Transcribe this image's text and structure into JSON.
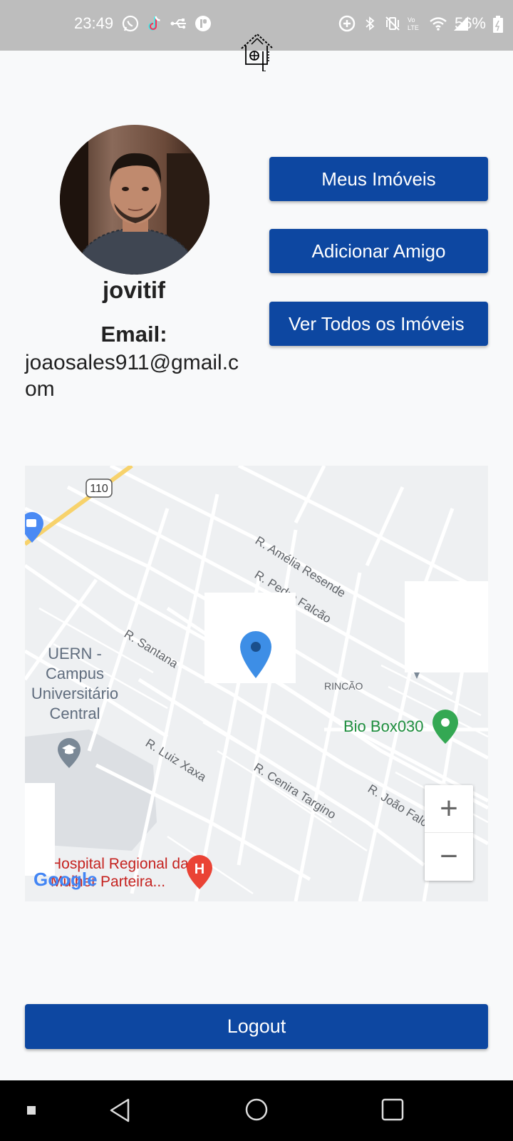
{
  "status_bar": {
    "time": "23:49",
    "battery": "56%",
    "left_icons": [
      "whatsapp-icon",
      "tiktok-icon",
      "usb-icon",
      "app-icon"
    ],
    "right_icons": [
      "data-saver-icon",
      "bluetooth-icon",
      "vibrate-icon",
      "volte-icon",
      "wifi-icon",
      "signal-icon"
    ]
  },
  "app": {
    "logo_icon": "house-location-icon"
  },
  "profile": {
    "username": "jovitif",
    "email_label": "Email:",
    "email": "joaosales911@gmail.com"
  },
  "actions": {
    "my_properties": "Meus Imóveis",
    "add_friend": "Adicionar Amigo",
    "view_all_properties": "Ver Todos os Imóveis"
  },
  "map": {
    "highway_number": "110",
    "streets": [
      "R. Amélia Resende",
      "R. Pedro Falcão",
      "R. Santana",
      "R. Luiz Xaxa",
      "R. Cenira Targino",
      "R. João Falcão"
    ],
    "neighborhood": "RINCÃO",
    "places": {
      "university": "UERN - Campus Universitário Central",
      "biobox": "Bio Box030",
      "hospital": "Hospital Regional da Mulher Parteira..."
    },
    "attribution": "Google",
    "zoom_in": "+",
    "zoom_out": "−",
    "marker_color": "#3d8ee6"
  },
  "logout": {
    "label": "Logout"
  },
  "colors": {
    "primary": "#0d47a1",
    "status_bar": "#bdbdbd"
  }
}
